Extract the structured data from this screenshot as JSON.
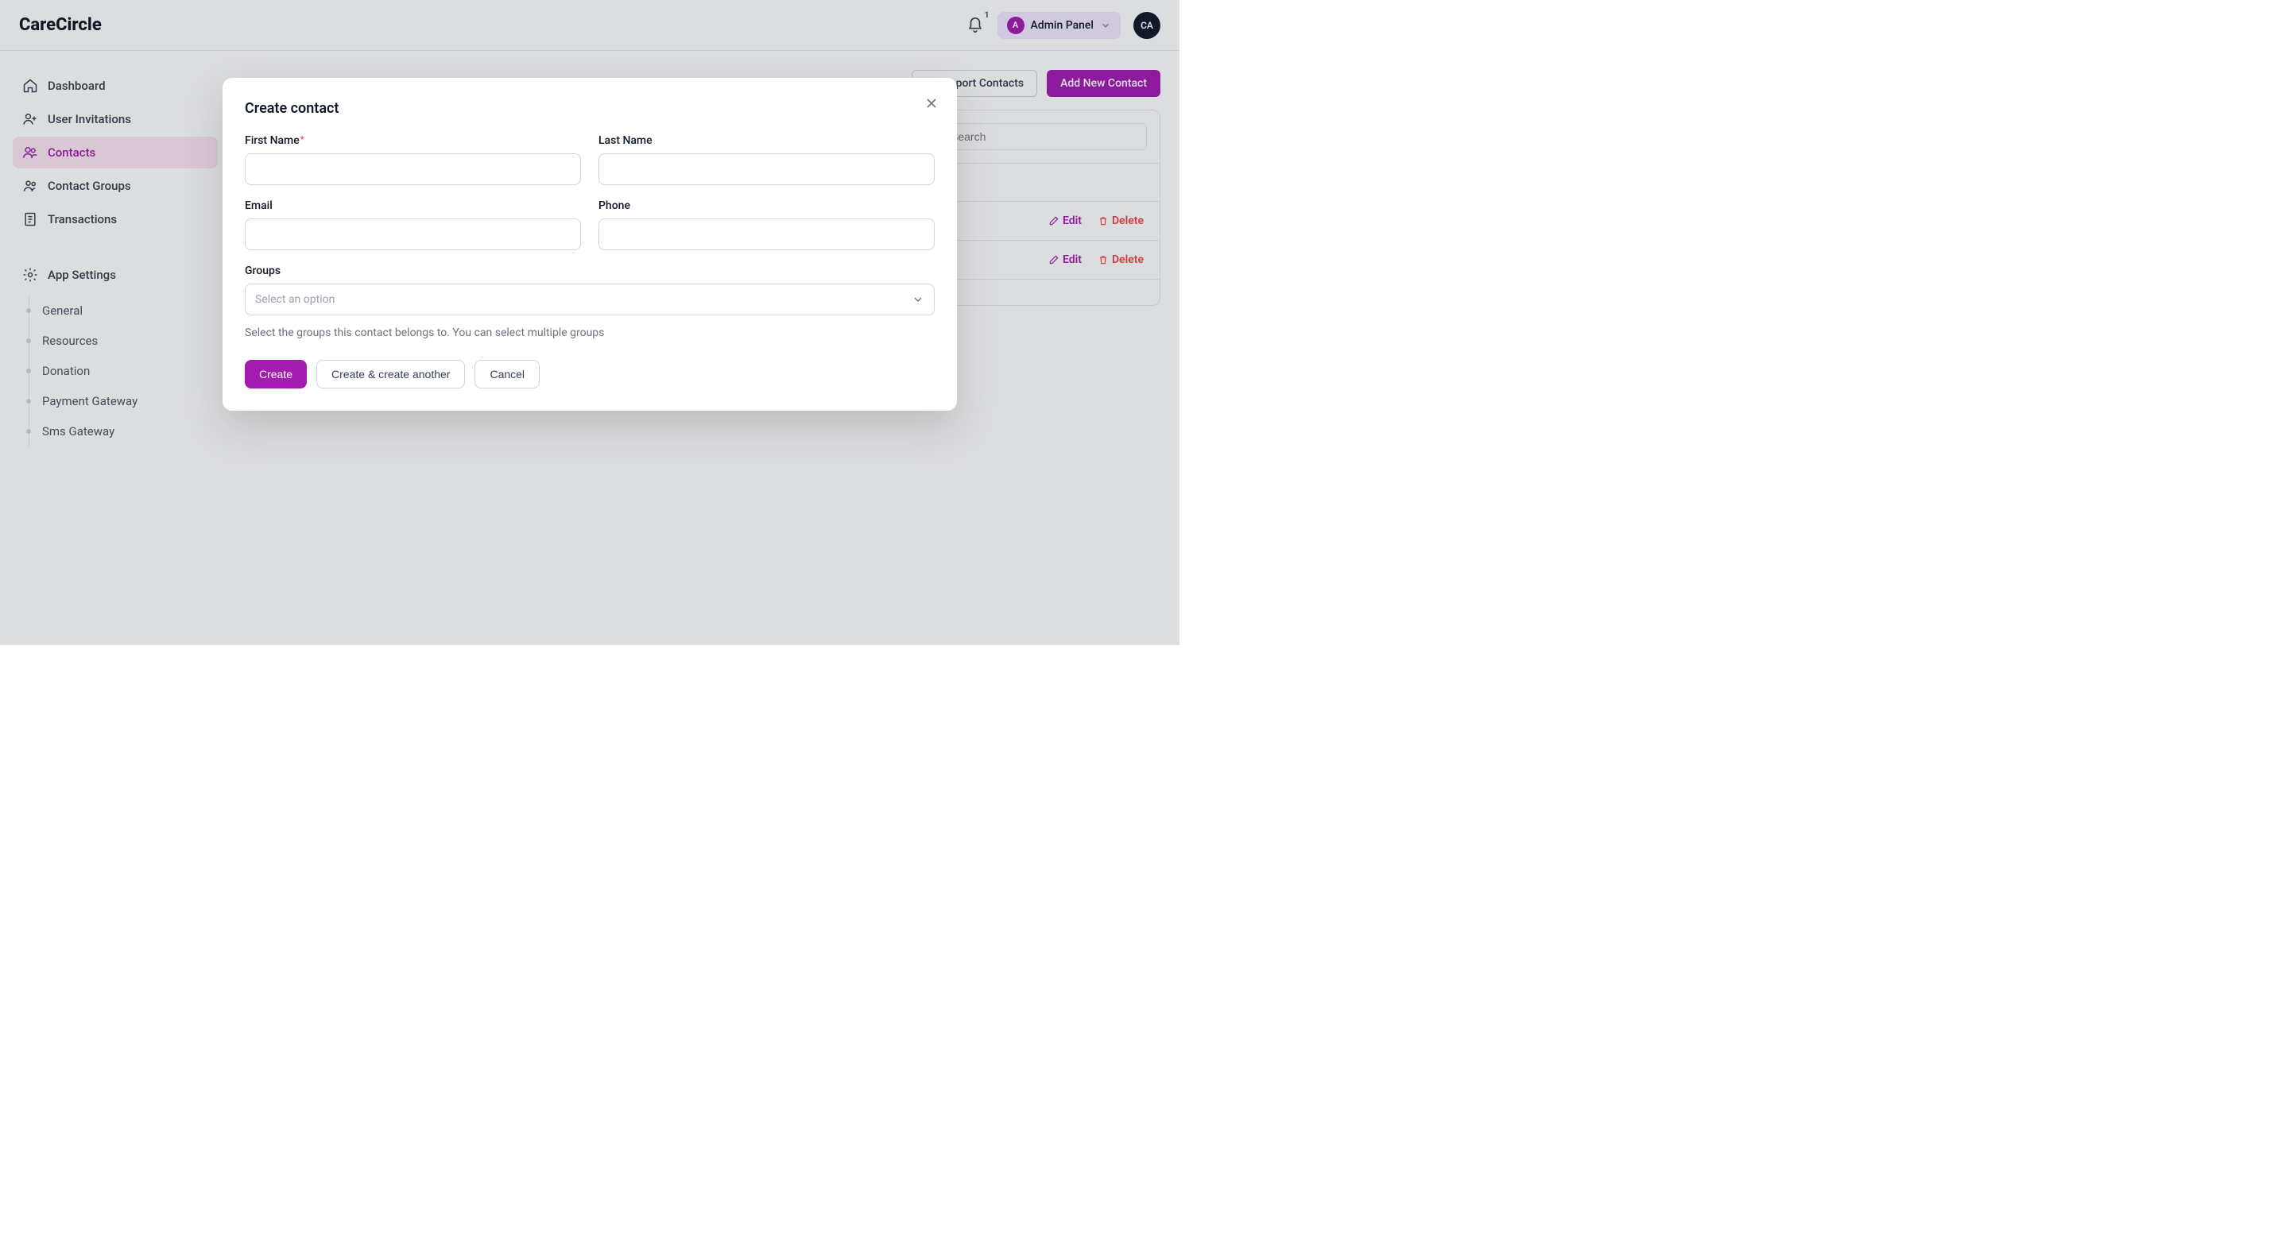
{
  "brand": "CareCircle",
  "header": {
    "notification_count": "1",
    "admin_avatar_letter": "A",
    "admin_label": "Admin Panel",
    "user_avatar_initials": "CA"
  },
  "sidebar": {
    "items": [
      {
        "id": "dashboard",
        "label": "Dashboard"
      },
      {
        "id": "user-invitations",
        "label": "User Invitations"
      },
      {
        "id": "contacts",
        "label": "Contacts",
        "active": true
      },
      {
        "id": "contact-groups",
        "label": "Contact Groups"
      },
      {
        "id": "transactions",
        "label": "Transactions"
      }
    ],
    "settings_label": "App Settings",
    "settings_sub": [
      {
        "id": "general",
        "label": "General"
      },
      {
        "id": "resources",
        "label": "Resources"
      },
      {
        "id": "donation",
        "label": "Donation"
      },
      {
        "id": "payment-gateway",
        "label": "Payment Gateway"
      },
      {
        "id": "sms-gateway",
        "label": "Sms Gateway"
      }
    ]
  },
  "page": {
    "import_button": "Import Contacts",
    "add_button": "Add New Contact",
    "search_placeholder": "Search",
    "rows": [
      {
        "edit": "Edit",
        "delete": "Delete"
      },
      {
        "edit": "Edit",
        "delete": "Delete"
      }
    ]
  },
  "modal": {
    "title": "Create contact",
    "first_name_label": "First Name",
    "last_name_label": "Last Name",
    "email_label": "Email",
    "phone_label": "Phone",
    "groups_label": "Groups",
    "groups_placeholder": "Select an option",
    "groups_help": "Select the groups this contact belongs to. You can select multiple groups",
    "create_button": "Create",
    "create_another_button": "Create & create another",
    "cancel_button": "Cancel"
  }
}
